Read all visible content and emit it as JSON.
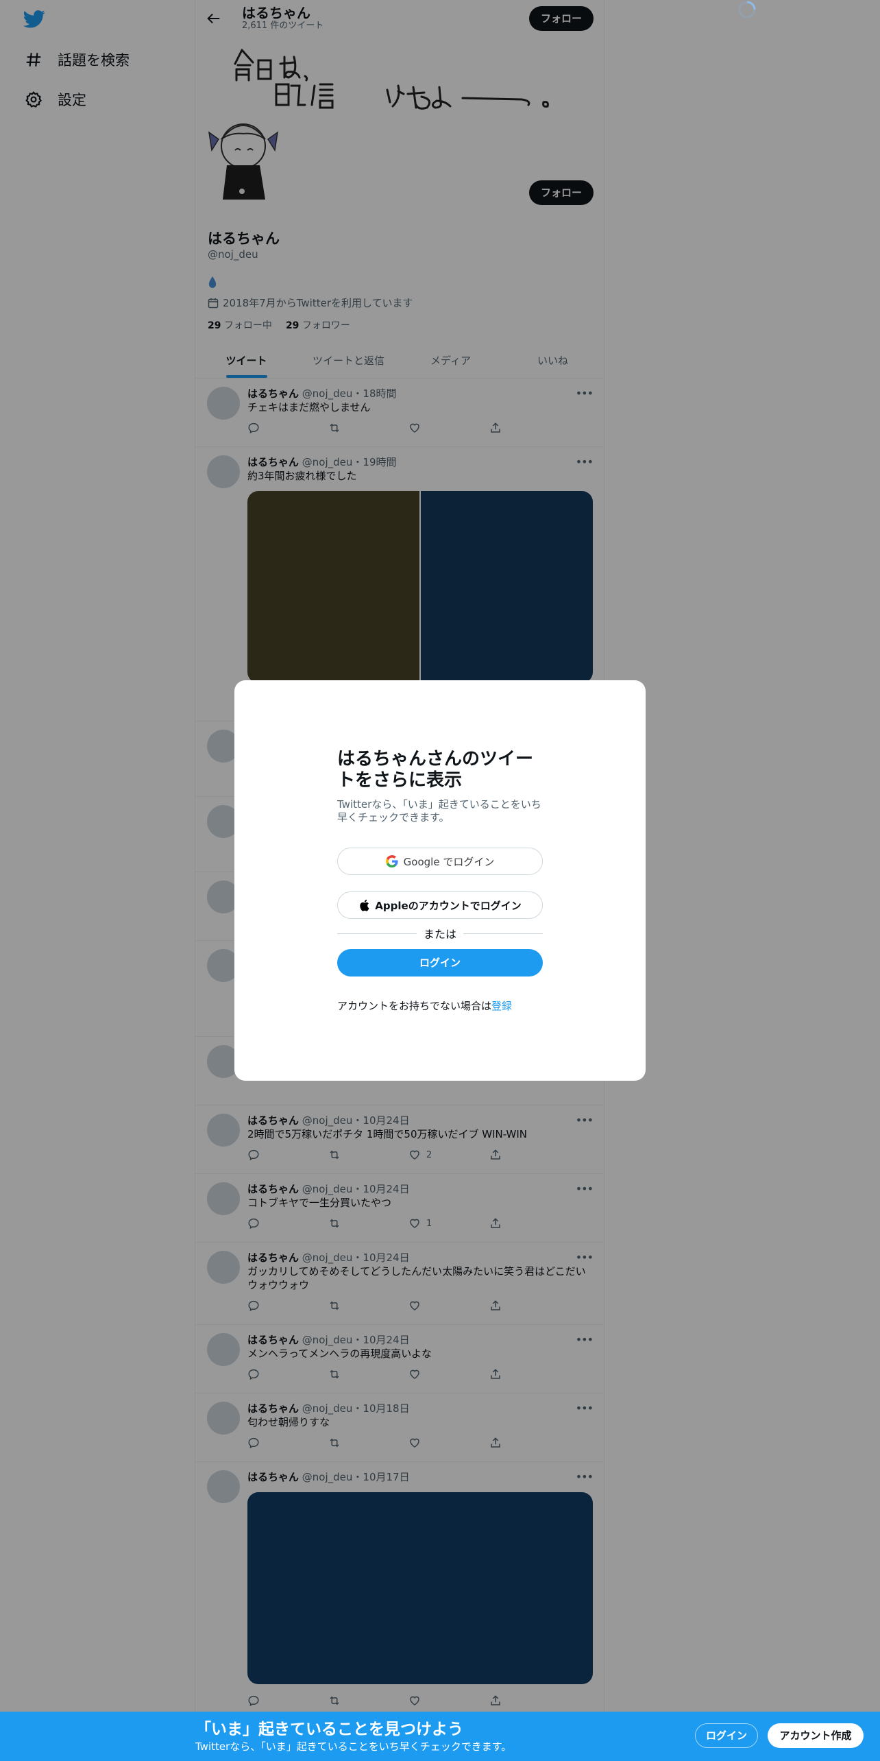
{
  "nav": {
    "explore_label": "話題を検索",
    "settings_label": "設定"
  },
  "header": {
    "name": "はるちゃん",
    "tweet_count": "2,611 件のツイート",
    "follow_label": "フォロー"
  },
  "banner": {
    "handwriting_line1": "今日は、",
    "handwriting_line2": "配信　やるよー。"
  },
  "profile": {
    "name": "はるちゃん",
    "handle": "@noj_deu",
    "bio_icon": "droplet-icon",
    "joined": "2018年7月からTwitterを利用しています",
    "following_count": "29",
    "following_label": "フォロー中",
    "followers_count": "29",
    "followers_label": "フォロワー",
    "follow_label": "フォロー"
  },
  "tabs": [
    "ツイート",
    "ツイートと返信",
    "メディア",
    "いいね"
  ],
  "tweets": [
    {
      "name": "はるちゃん",
      "meta": "@noj_deu・18時間",
      "text": "チェキはまだ燃やしません",
      "likes": ""
    },
    {
      "name": "はるちゃん",
      "meta": "@noj_deu・19時間",
      "text": "約3年間お疲れ様でした",
      "likes": ""
    },
    {
      "name": "はるちゃん",
      "meta": "@noj_deu・10月24日",
      "text": "2時間で5万稼いだポチタ 1時間で50万稼いだイブ WIN-WIN",
      "likes": "2"
    },
    {
      "name": "はるちゃん",
      "meta": "@noj_deu・10月24日",
      "text": "コトブキヤで一生分買いたやつ",
      "likes": "1"
    },
    {
      "name": "はるちゃん",
      "meta": "@noj_deu・10月24日",
      "text": "ガッカリしてめそめそしてどうしたんだい太陽みたいに笑う君はどこだいウォウウォウ",
      "likes": ""
    },
    {
      "name": "はるちゃん",
      "meta": "@noj_deu・10月24日",
      "text": "メンヘラってメンヘラの再現度高いよな",
      "likes": ""
    },
    {
      "name": "はるちゃん",
      "meta": "@noj_deu・10月18日",
      "text": "匂わせ朝帰りすな",
      "likes": ""
    },
    {
      "name": "はるちゃん",
      "meta": "@noj_deu・10月17日",
      "text": "",
      "likes": ""
    }
  ],
  "modal": {
    "title": "はるちゃんさんのツイートをさらに表示",
    "subtitle": "Twitterなら、「いま」起きていることをいち早くチェックできます。",
    "google_label": "Google でログイン",
    "apple_label": "Appleのアカウントでログイン",
    "or_label": "または",
    "login_label": "ログイン",
    "signup_prompt": "アカウントをお持ちでない場合は",
    "signup_link": "登録"
  },
  "bottom_bar": {
    "title": "「いま」起きていることを見つけよう",
    "subtitle": "Twitterなら、「いま」起きていることをいち早くチェックできます。",
    "login_label": "ログイン",
    "signup_label": "アカウント作成"
  },
  "colors": {
    "accent": "#1d9bf0",
    "media_olive": "#4a4327",
    "media_navy": "#15395b",
    "media_blue": "#123c67"
  }
}
